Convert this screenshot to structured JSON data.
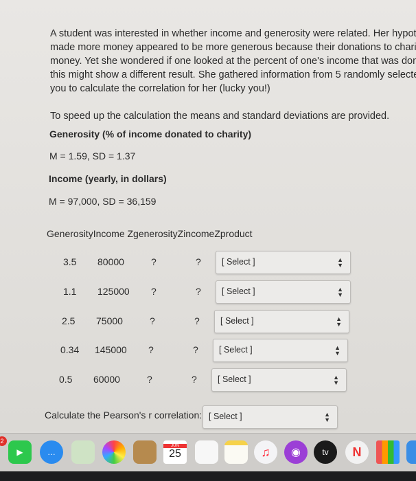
{
  "intro": [
    "A student was interested in whether income and generosity were related. Her hypot",
    "made more money appeared to be more generous because their donations to charity",
    "money. Yet she wondered if one looked at the percent of one's income that was don",
    "this might show a different result. She gathered information from 5 randomly selecte",
    "you to calculate the correlation for her (lucky you!)"
  ],
  "speedup": "To speed up the calculation the means and standard deviations are provided.",
  "generosity": {
    "label": "Generosity (% of income donated to charity)",
    "stats": "M = 1.59, SD = 1.37"
  },
  "income": {
    "label": "Income (yearly, in dollars)",
    "stats": "M = 97,000, SD = 36,159"
  },
  "table_header": "GenerosityIncome ZgenerosityZincomeZproduct",
  "rows": [
    {
      "g": "3.5",
      "i": "80000",
      "zg": "?",
      "zi": "?",
      "select": "[ Select ]"
    },
    {
      "g": "1.1",
      "i": "125000",
      "zg": "?",
      "zi": "?",
      "select": "[ Select ]"
    },
    {
      "g": "2.5",
      "i": "75000",
      "zg": "?",
      "zi": "?",
      "select": "[ Select ]"
    },
    {
      "g": "0.34",
      "i": "145000",
      "zg": "?",
      "zi": "?",
      "select": "[ Select ]"
    },
    {
      "g": "0.5",
      "i": "60000",
      "zg": "?",
      "zi": "?",
      "select": "[ Select ]"
    }
  ],
  "pearson": {
    "label": "Calculate the Pearson's r correlation:",
    "select": "[ Select ]"
  },
  "dock": {
    "badge": "2",
    "calendar_month": "JUN",
    "calendar_day": "25",
    "tv": "tv",
    "apps": [
      "facetime",
      "messages",
      "maps",
      "photos",
      "contacts",
      "calendar",
      "reminders",
      "notes",
      "music",
      "podcasts",
      "apple-tv",
      "news",
      "numbers",
      "keynote"
    ]
  }
}
